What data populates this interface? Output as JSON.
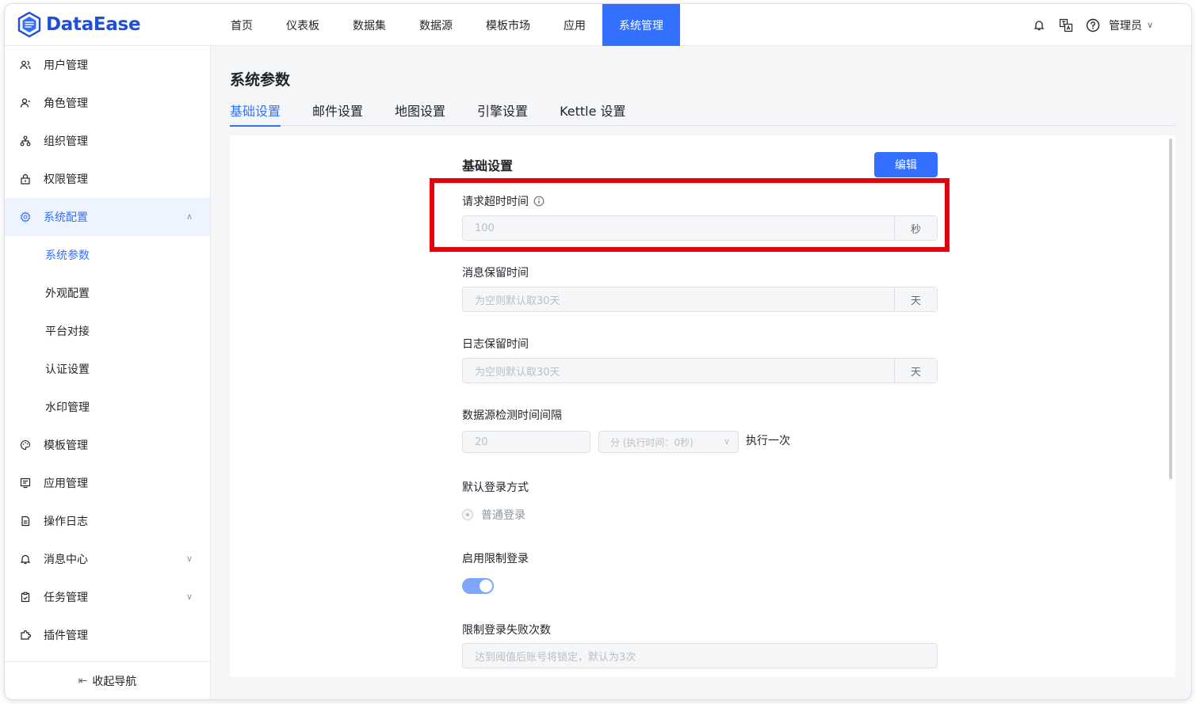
{
  "app": {
    "name": "DataEase",
    "brand_color": "#3370ff",
    "logo_color": "#1e4fd8"
  },
  "topnav": {
    "items": [
      {
        "label": "首页"
      },
      {
        "label": "仪表板"
      },
      {
        "label": "数据集"
      },
      {
        "label": "数据源"
      },
      {
        "label": "模板市场"
      },
      {
        "label": "应用"
      },
      {
        "label": "系统管理",
        "active": true
      }
    ]
  },
  "header_right": {
    "icons": [
      "notification-icon",
      "translate-icon",
      "help-icon"
    ],
    "user_label": "管理员"
  },
  "sidebar": {
    "items": [
      {
        "label": "用户管理",
        "icon": "user-group-icon"
      },
      {
        "label": "角色管理",
        "icon": "role-icon"
      },
      {
        "label": "组织管理",
        "icon": "org-tree-icon"
      },
      {
        "label": "权限管理",
        "icon": "lock-icon"
      },
      {
        "label": "系统配置",
        "icon": "gear-icon",
        "expanded": true
      }
    ],
    "submenu": [
      {
        "label": "系统参数",
        "active": true
      },
      {
        "label": "外观配置"
      },
      {
        "label": "平台对接"
      },
      {
        "label": "认证设置"
      },
      {
        "label": "水印管理"
      }
    ],
    "items_after": [
      {
        "label": "模板管理",
        "icon": "palette-icon"
      },
      {
        "label": "应用管理",
        "icon": "app-icon"
      },
      {
        "label": "操作日志",
        "icon": "log-icon"
      },
      {
        "label": "消息中心",
        "icon": "bell-icon",
        "has_arrow": true
      },
      {
        "label": "任务管理",
        "icon": "clipboard-icon",
        "has_arrow": true
      },
      {
        "label": "插件管理",
        "icon": "plugin-icon"
      }
    ],
    "collapse_label": "收起导航"
  },
  "main": {
    "page_title": "系统参数",
    "tabs": [
      {
        "label": "基础设置",
        "active": true
      },
      {
        "label": "邮件设置"
      },
      {
        "label": "地图设置"
      },
      {
        "label": "引擎设置"
      },
      {
        "label": "Kettle 设置"
      }
    ]
  },
  "form": {
    "title": "基础设置",
    "edit_label": "编辑",
    "request_timeout": {
      "label": "请求超时时间",
      "value": "100",
      "unit": "秒"
    },
    "message_retention": {
      "label": "消息保留时间",
      "placeholder": "为空则默认取30天",
      "unit": "天"
    },
    "log_retention": {
      "label": "日志保留时间",
      "placeholder": "为空则默认取30天",
      "unit": "天"
    },
    "ds_check_interval": {
      "label": "数据源检测时间间隔",
      "value": "20",
      "select_value": "分 (执行时间：0秒)",
      "suffix_text": "执行一次"
    },
    "default_login": {
      "label": "默认登录方式",
      "option": "普通登录"
    },
    "limit_login": {
      "label": "启用限制登录",
      "enabled": true
    },
    "limit_fail_count": {
      "label": "限制登录失败次数",
      "placeholder": "达到阈值后账号将锁定，默认为3次"
    }
  },
  "annotation": {
    "highlight_color": "#e8000b"
  }
}
